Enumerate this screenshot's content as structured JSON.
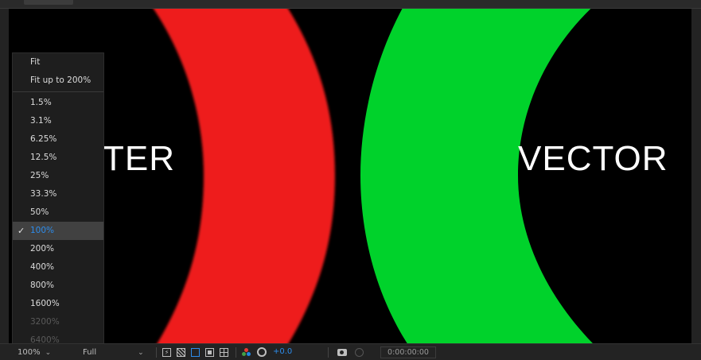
{
  "viewer": {
    "left_label": "TER",
    "right_label": "VECTOR",
    "colors": {
      "background": "#000000",
      "raster_arc": "#ee1c1c",
      "vector_arc": "#00d22b",
      "text": "#ffffff"
    }
  },
  "zoom_menu": {
    "items": [
      {
        "label": "Fit",
        "state": "normal"
      },
      {
        "label": "Fit up to 200%",
        "state": "normal"
      },
      {
        "separator": true
      },
      {
        "label": "1.5%",
        "state": "normal"
      },
      {
        "label": "3.1%",
        "state": "normal"
      },
      {
        "label": "6.25%",
        "state": "normal"
      },
      {
        "label": "12.5%",
        "state": "normal"
      },
      {
        "label": "25%",
        "state": "normal"
      },
      {
        "label": "33.3%",
        "state": "normal"
      },
      {
        "label": "50%",
        "state": "normal"
      },
      {
        "label": "100%",
        "state": "selected"
      },
      {
        "label": "200%",
        "state": "normal"
      },
      {
        "label": "400%",
        "state": "normal"
      },
      {
        "label": "800%",
        "state": "normal"
      },
      {
        "label": "1600%",
        "state": "normal"
      },
      {
        "label": "3200%",
        "state": "disabled"
      },
      {
        "label": "6400%",
        "state": "disabled"
      }
    ],
    "check_mark": "✓",
    "selected_color": "#2d8ceb"
  },
  "bottom_bar": {
    "zoom_value": "100%",
    "resolution_value": "Full",
    "exposure_value": "+0.0",
    "timecode": "0:00:00:00",
    "icons": [
      "fast-preview-icon",
      "transparency-grid-icon",
      "mask-path-icon",
      "region-of-interest-icon",
      "guides-icon",
      "color-channels-icon",
      "exposure-reset-icon",
      "snapshot-camera-icon",
      "show-snapshot-icon"
    ]
  }
}
